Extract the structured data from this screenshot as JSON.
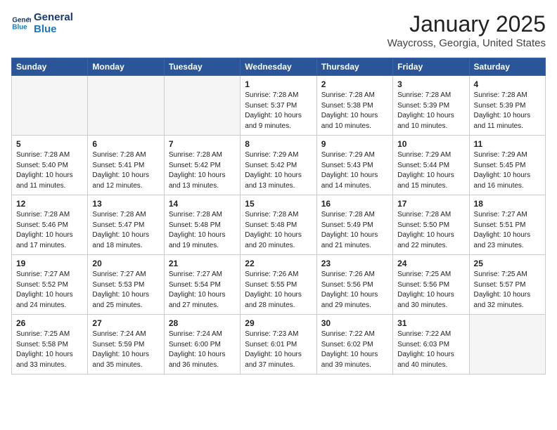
{
  "logo": {
    "line1": "General",
    "line2": "Blue"
  },
  "title": "January 2025",
  "location": "Waycross, Georgia, United States",
  "days_header": [
    "Sunday",
    "Monday",
    "Tuesday",
    "Wednesday",
    "Thursday",
    "Friday",
    "Saturday"
  ],
  "weeks": [
    [
      {
        "num": "",
        "info": ""
      },
      {
        "num": "",
        "info": ""
      },
      {
        "num": "",
        "info": ""
      },
      {
        "num": "1",
        "info": "Sunrise: 7:28 AM\nSunset: 5:37 PM\nDaylight: 10 hours\nand 9 minutes."
      },
      {
        "num": "2",
        "info": "Sunrise: 7:28 AM\nSunset: 5:38 PM\nDaylight: 10 hours\nand 10 minutes."
      },
      {
        "num": "3",
        "info": "Sunrise: 7:28 AM\nSunset: 5:39 PM\nDaylight: 10 hours\nand 10 minutes."
      },
      {
        "num": "4",
        "info": "Sunrise: 7:28 AM\nSunset: 5:39 PM\nDaylight: 10 hours\nand 11 minutes."
      }
    ],
    [
      {
        "num": "5",
        "info": "Sunrise: 7:28 AM\nSunset: 5:40 PM\nDaylight: 10 hours\nand 11 minutes."
      },
      {
        "num": "6",
        "info": "Sunrise: 7:28 AM\nSunset: 5:41 PM\nDaylight: 10 hours\nand 12 minutes."
      },
      {
        "num": "7",
        "info": "Sunrise: 7:28 AM\nSunset: 5:42 PM\nDaylight: 10 hours\nand 13 minutes."
      },
      {
        "num": "8",
        "info": "Sunrise: 7:29 AM\nSunset: 5:42 PM\nDaylight: 10 hours\nand 13 minutes."
      },
      {
        "num": "9",
        "info": "Sunrise: 7:29 AM\nSunset: 5:43 PM\nDaylight: 10 hours\nand 14 minutes."
      },
      {
        "num": "10",
        "info": "Sunrise: 7:29 AM\nSunset: 5:44 PM\nDaylight: 10 hours\nand 15 minutes."
      },
      {
        "num": "11",
        "info": "Sunrise: 7:29 AM\nSunset: 5:45 PM\nDaylight: 10 hours\nand 16 minutes."
      }
    ],
    [
      {
        "num": "12",
        "info": "Sunrise: 7:28 AM\nSunset: 5:46 PM\nDaylight: 10 hours\nand 17 minutes."
      },
      {
        "num": "13",
        "info": "Sunrise: 7:28 AM\nSunset: 5:47 PM\nDaylight: 10 hours\nand 18 minutes."
      },
      {
        "num": "14",
        "info": "Sunrise: 7:28 AM\nSunset: 5:48 PM\nDaylight: 10 hours\nand 19 minutes."
      },
      {
        "num": "15",
        "info": "Sunrise: 7:28 AM\nSunset: 5:48 PM\nDaylight: 10 hours\nand 20 minutes."
      },
      {
        "num": "16",
        "info": "Sunrise: 7:28 AM\nSunset: 5:49 PM\nDaylight: 10 hours\nand 21 minutes."
      },
      {
        "num": "17",
        "info": "Sunrise: 7:28 AM\nSunset: 5:50 PM\nDaylight: 10 hours\nand 22 minutes."
      },
      {
        "num": "18",
        "info": "Sunrise: 7:27 AM\nSunset: 5:51 PM\nDaylight: 10 hours\nand 23 minutes."
      }
    ],
    [
      {
        "num": "19",
        "info": "Sunrise: 7:27 AM\nSunset: 5:52 PM\nDaylight: 10 hours\nand 24 minutes."
      },
      {
        "num": "20",
        "info": "Sunrise: 7:27 AM\nSunset: 5:53 PM\nDaylight: 10 hours\nand 25 minutes."
      },
      {
        "num": "21",
        "info": "Sunrise: 7:27 AM\nSunset: 5:54 PM\nDaylight: 10 hours\nand 27 minutes."
      },
      {
        "num": "22",
        "info": "Sunrise: 7:26 AM\nSunset: 5:55 PM\nDaylight: 10 hours\nand 28 minutes."
      },
      {
        "num": "23",
        "info": "Sunrise: 7:26 AM\nSunset: 5:56 PM\nDaylight: 10 hours\nand 29 minutes."
      },
      {
        "num": "24",
        "info": "Sunrise: 7:25 AM\nSunset: 5:56 PM\nDaylight: 10 hours\nand 30 minutes."
      },
      {
        "num": "25",
        "info": "Sunrise: 7:25 AM\nSunset: 5:57 PM\nDaylight: 10 hours\nand 32 minutes."
      }
    ],
    [
      {
        "num": "26",
        "info": "Sunrise: 7:25 AM\nSunset: 5:58 PM\nDaylight: 10 hours\nand 33 minutes."
      },
      {
        "num": "27",
        "info": "Sunrise: 7:24 AM\nSunset: 5:59 PM\nDaylight: 10 hours\nand 35 minutes."
      },
      {
        "num": "28",
        "info": "Sunrise: 7:24 AM\nSunset: 6:00 PM\nDaylight: 10 hours\nand 36 minutes."
      },
      {
        "num": "29",
        "info": "Sunrise: 7:23 AM\nSunset: 6:01 PM\nDaylight: 10 hours\nand 37 minutes."
      },
      {
        "num": "30",
        "info": "Sunrise: 7:22 AM\nSunset: 6:02 PM\nDaylight: 10 hours\nand 39 minutes."
      },
      {
        "num": "31",
        "info": "Sunrise: 7:22 AM\nSunset: 6:03 PM\nDaylight: 10 hours\nand 40 minutes."
      },
      {
        "num": "",
        "info": ""
      }
    ]
  ]
}
